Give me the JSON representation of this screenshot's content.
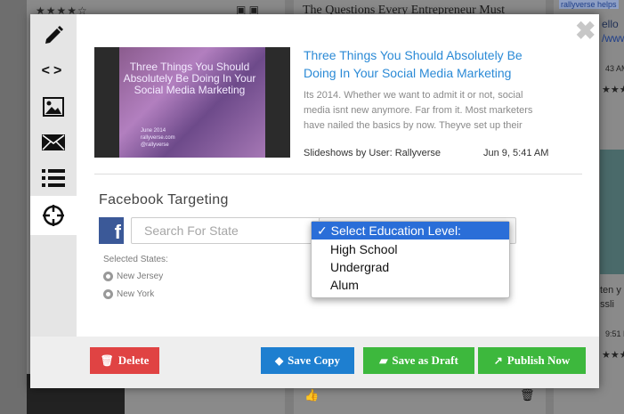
{
  "background": {
    "stars": "★★★★☆",
    "card_headline": "The Questions Every Entrepreneur Must",
    "helps_text": "rallyverse helps",
    "hello_text": "ello",
    "url_text": "/www",
    "time1": "43 AM",
    "time2": "9:51 P",
    "ten_text": "ten y",
    "ssl_text": "ssli",
    "stars_small": "★★★"
  },
  "sidebar": {
    "items": [
      {
        "icon": "pencil-icon"
      },
      {
        "icon": "code-icon",
        "glyph": "<>"
      },
      {
        "icon": "image-icon"
      },
      {
        "icon": "envelope-icon"
      },
      {
        "icon": "list-icon"
      },
      {
        "icon": "crosshair-icon",
        "active": true
      }
    ]
  },
  "close_glyph": "✖",
  "article": {
    "thumb_title": "Three Things You Should Absolutely Be Doing In Your Social Media Marketing",
    "thumb_date": "June 2014",
    "thumb_site": "rallyverse.com",
    "thumb_handle": "@rallyverse",
    "title": "Three Things You Should Absolutely Be Doing In Your Social Media Marketing",
    "body": "Its 2014. Whether we want to admit it or not, social media isnt new anymore. Far from it. Most marketers have nailed the basics by now. Theyve set up their",
    "byline": "Slideshows by User: Rallyverse",
    "date": "Jun 9, 5:41 AM"
  },
  "targeting": {
    "title": "Facebook Targeting",
    "fb_glyph": "f",
    "search_placeholder": "Search For State",
    "education": {
      "options": [
        "Select Education Level:",
        "High School",
        "Undergrad",
        "Alum"
      ],
      "selected_index": 0,
      "check": "✓"
    },
    "selected_states_label": "Selected States:",
    "states": [
      "New Jersey",
      "New York"
    ]
  },
  "footer": {
    "delete_label": "Delete",
    "save_copy_label": "Save Copy",
    "save_draft_label": "Save as Draft",
    "publish_label": "Publish Now"
  },
  "colors": {
    "delete": "#e04343",
    "save_copy": "#1e7fd0",
    "save_draft": "#3db83d",
    "publish": "#3db83d",
    "link": "#2b8ad6",
    "facebook": "#3b5998",
    "dropdown_highlight": "#2a6ed8"
  }
}
